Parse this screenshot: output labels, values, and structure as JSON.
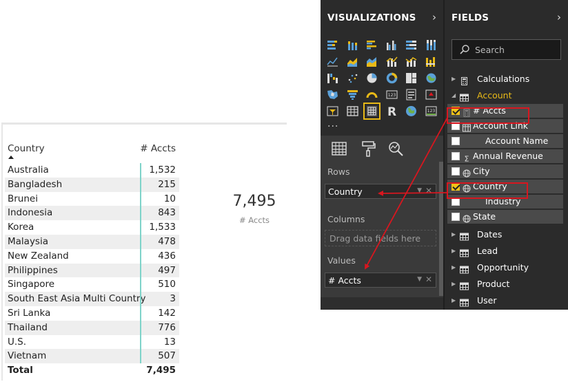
{
  "matrix": {
    "headers": {
      "country": "Country",
      "accts": "# Accts"
    },
    "rows": [
      {
        "country": "Australia",
        "accts": "1,532"
      },
      {
        "country": "Bangladesh",
        "accts": "215"
      },
      {
        "country": "Brunei",
        "accts": "10"
      },
      {
        "country": "Indonesia",
        "accts": "843"
      },
      {
        "country": "Korea",
        "accts": "1,533"
      },
      {
        "country": "Malaysia",
        "accts": "478"
      },
      {
        "country": "New Zealand",
        "accts": "436"
      },
      {
        "country": "Philippines",
        "accts": "497"
      },
      {
        "country": "Singapore",
        "accts": "510"
      },
      {
        "country": "South East Asia Multi Country",
        "accts": "3"
      },
      {
        "country": "Sri Lanka",
        "accts": "142"
      },
      {
        "country": "Thailand",
        "accts": "776"
      },
      {
        "country": "U.S.",
        "accts": "13"
      },
      {
        "country": "Vietnam",
        "accts": "507"
      }
    ],
    "total": {
      "label": "Total",
      "accts": "7,495"
    },
    "sort": "country-ascending"
  },
  "card": {
    "value": "7,495",
    "label": "# Accts"
  },
  "visualizations": {
    "title": "VISUALIZATIONS",
    "more": "...",
    "tabs": [
      "fields-tab-icon",
      "format-paint-roller-icon",
      "analytics-magnifier-icon"
    ],
    "active_tab": "fields-tab-icon",
    "wells": {
      "rows_title": "Rows",
      "rows_field": "Country",
      "columns_title": "Columns",
      "columns_placeholder": "Drag data fields here",
      "values_title": "Values",
      "values_field": "# Accts"
    }
  },
  "fields": {
    "title": "FIELDS",
    "search_placeholder": "Search",
    "tables": [
      {
        "name": "Calculations",
        "expanded": false,
        "icon": "calculator-icon"
      },
      {
        "name": "Account",
        "expanded": true,
        "icon": "table-icon",
        "fields": [
          {
            "name": "# Accts",
            "checked": true,
            "type": "calculator-icon"
          },
          {
            "name": "Account Link",
            "checked": false,
            "type": "link-icon"
          },
          {
            "name": "Account Name",
            "checked": false,
            "type": ""
          },
          {
            "name": "Annual Revenue",
            "checked": false,
            "type": "sigma-icon"
          },
          {
            "name": "City",
            "checked": false,
            "type": "globe-icon"
          },
          {
            "name": "Country",
            "checked": true,
            "type": "globe-icon"
          },
          {
            "name": "Industry",
            "checked": false,
            "type": ""
          },
          {
            "name": "State",
            "checked": false,
            "type": "globe-icon"
          }
        ]
      },
      {
        "name": "Dates",
        "expanded": false,
        "icon": "table-icon"
      },
      {
        "name": "Lead",
        "expanded": false,
        "icon": "table-icon"
      },
      {
        "name": "Opportunity",
        "expanded": false,
        "icon": "table-icon"
      },
      {
        "name": "Product",
        "expanded": false,
        "icon": "table-icon"
      },
      {
        "name": "User",
        "expanded": false,
        "icon": "table-icon"
      }
    ]
  },
  "colors": {
    "accent": "#e8b917",
    "highlight": "#d8161f",
    "matrix_divider": "#7ed3c9",
    "pane_bg": "#2b2b2b"
  }
}
